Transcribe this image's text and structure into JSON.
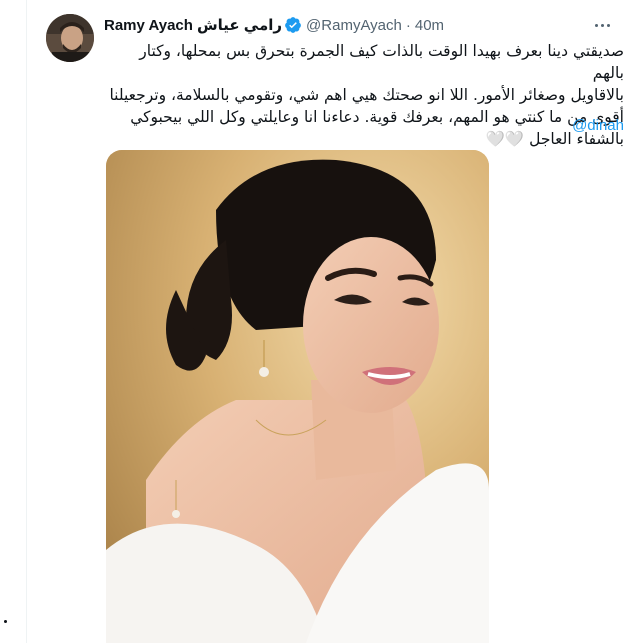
{
  "tweet": {
    "author_name": "Ramy Ayach",
    "author_name_ar": "رامي عياش",
    "handle": "@RamyAyach",
    "separator": "·",
    "time": "40m",
    "lines": [
      "صديقتي دينا بعرف بهيدا الوقت بالذات كيف الجمرة بتحرق بس بمحلها، وكتار بالهم",
      "بالاقاويل وصغائر الأمور. اللا انو صحتك هيي اهم شي، وتقومي بالسلامة، وترجعيلنا",
      "أقوى من ما كنتي هو المهم، بعرفك قوية. دعاءنا انا وعايلتي وكل اللي بيحبوكي",
      "بالشفاء العاجل"
    ],
    "hearts": "🤍🤍",
    "mention": "@dinah"
  },
  "colors": {
    "text": "#0f1419",
    "secondary": "#536471",
    "link": "#1d9bf0",
    "verified": "#1d9bf0"
  },
  "icons": {
    "verified": "verified-badge-icon",
    "more": "more-horizontal-icon"
  }
}
